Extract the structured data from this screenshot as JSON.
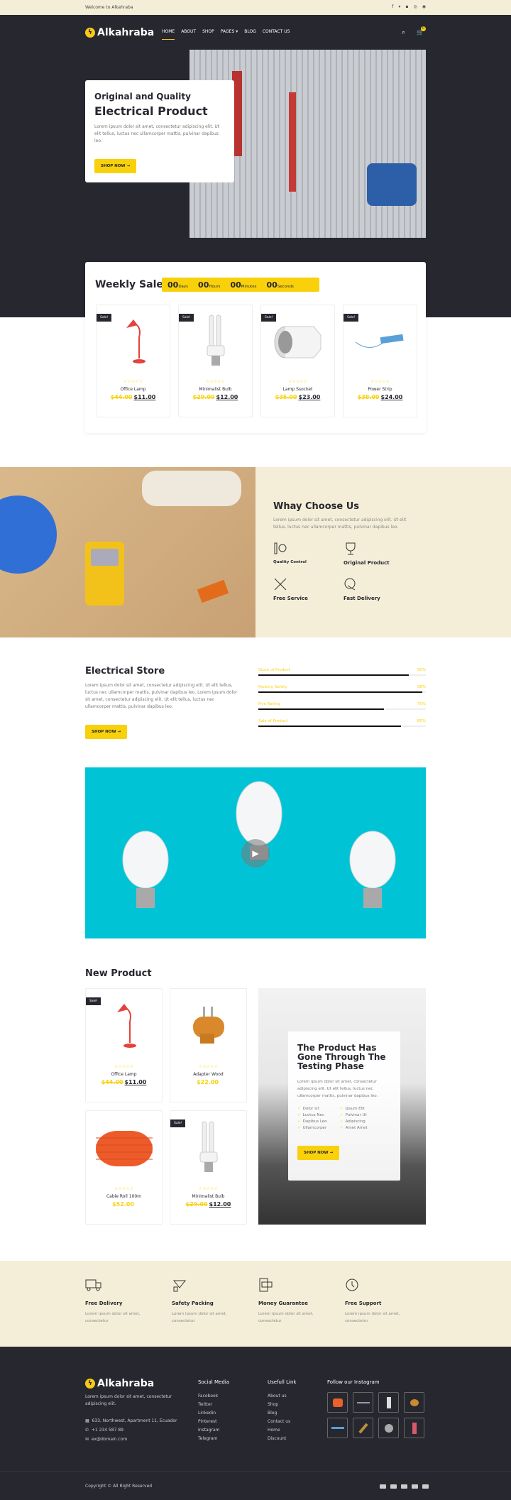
{
  "topbar": {
    "welcome": "Welcome to Alkahraba",
    "social_icons": [
      "facebook-icon",
      "twitter-icon",
      "youtube-icon",
      "dribbble-icon",
      "pinterest-icon"
    ]
  },
  "header": {
    "logo": "Alkahraba",
    "nav": [
      "HOME",
      "ABOUT",
      "SHOP",
      "PAGES",
      "BLOG",
      "CONTACT US"
    ],
    "cart_count": "0"
  },
  "hero": {
    "subtitle": "Original and Quality",
    "title": "Electrical Product",
    "text": "Lorem ipsum dolor sit amet, consectetur adipiscing elit. Ut elit tellus, luctus nec ullamcorper mattis, pulvinar dapibus leo.",
    "button": "SHOP NOW"
  },
  "weekly_sale": {
    "title": "Weekly Sale",
    "timer": [
      {
        "value": "00",
        "unit": "Days"
      },
      {
        "value": "00",
        "unit": "Hours"
      },
      {
        "value": "00",
        "unit": "Minutes"
      },
      {
        "value": "00",
        "unit": "Seconds"
      }
    ],
    "products": [
      {
        "badge": "Sale!",
        "name": "Office Lamp",
        "old": "$44.00",
        "price": "$11.00"
      },
      {
        "badge": "Sale!",
        "name": "Minimalist Bulb",
        "old": "$29.00",
        "price": "$12.00"
      },
      {
        "badge": "Sale!",
        "name": "Lamp Ssocket",
        "old": "$35.00",
        "price": "$23.00"
      },
      {
        "badge": "Sale!",
        "name": "Power Strip",
        "old": "$38.00",
        "price": "$24.00"
      }
    ]
  },
  "why": {
    "title": "Whay Choose Us",
    "text": "Lorem ipsum dolor sit amet, consectetur adipiscing elit. Ut elit tellus, luctus nec ullamcorper mattis, pulvinar dapibus leo.",
    "features": [
      "Quality Control",
      "Original Product",
      "Free Service",
      "Fast Delivery"
    ]
  },
  "store": {
    "title": "Electrical Store",
    "text": "Lorem ipsum dolor sit amet, consectetur adipiscing elit. Ut elit tellus, luctus nec ullamcorper mattis, pulvinar dapibus leo. Lorem ipsum dolor sit amet, consectetur adipiscing elit. Ut elit tellus, luctus nec ullamcorper mattis, pulvinar dapibus leo.",
    "button": "SHOP NOW",
    "bars": [
      {
        "label": "Stock of Product",
        "percent": "90%",
        "value": 90
      },
      {
        "label": "Packing Safety",
        "percent": "98%",
        "value": 98
      },
      {
        "label": "Five Rating",
        "percent": "75%",
        "value": 75
      },
      {
        "label": "Sale of Product",
        "percent": "85%",
        "value": 85
      }
    ]
  },
  "new_product": {
    "title": "New Product",
    "products": [
      {
        "badge": "Sale!",
        "name": "Office Lamp",
        "old": "$44.00",
        "price": "$11.00"
      },
      {
        "badge": "",
        "name": "Adapter Wood",
        "old": "",
        "price": "$22.00"
      },
      {
        "badge": "",
        "name": "Cable Roll 100m",
        "old": "",
        "price": "$52.00"
      },
      {
        "badge": "Sale!",
        "name": "Minimalist Bulb",
        "old": "$29.00",
        "price": "$12.00"
      }
    ],
    "promo": {
      "title": "The Product Has Gone Through The Testing Phase",
      "text": "Lorem ipsum dolor sit amet, consectetur adipiscing elit. Ut elit tellus, luctus nec ullamcorper mattis, pulvinar dapibus leo.",
      "checks": [
        "Dolor sit",
        "Ipsum Elit",
        "Luctus Nec",
        "Pulvinar Ut",
        "Dapibus Leo",
        "Adipiscing",
        "Ullamcorper",
        "Amet Amet"
      ],
      "button": "SHOP NOW"
    }
  },
  "features": [
    {
      "title": "Free Delivery",
      "text": "Lorem ipsum dolor sit amet, consectetur"
    },
    {
      "title": "Safety Packing",
      "text": "Lorem ipsum dolor sit amet, consectetur"
    },
    {
      "title": "Money Guarantee",
      "text": "Lorem ipsum dolor sit amet, consectetur"
    },
    {
      "title": "Free Support",
      "text": "Lorem ipsum dolor sit amet, consectetur"
    }
  ],
  "footer": {
    "logo": "Alkahraba",
    "about": "Lorem ipsum dolor sit amet, consectetur adipiscing elit.",
    "address": "633, Northwest, Apartment 11, Ecuador",
    "phone": "+1 234 587 89",
    "email": "ex@domain.com",
    "social_title": "Social Media",
    "social": [
      "Facebook",
      "Twitter",
      "Linkedin",
      "Pinterest",
      "Instagram",
      "Telegram"
    ],
    "links_title": "Usefull Link",
    "links": [
      "About us",
      "Shop",
      "Blog",
      "Contact us",
      "Home",
      "Discount"
    ],
    "instagram_title": "Follow our Instagram",
    "copyright": "Copyright © All Right Reserved"
  },
  "colors": {
    "accent": "#f9d10b",
    "dark": "#27272f",
    "cream": "#f4eed8",
    "video_bg": "#00c4d6"
  }
}
